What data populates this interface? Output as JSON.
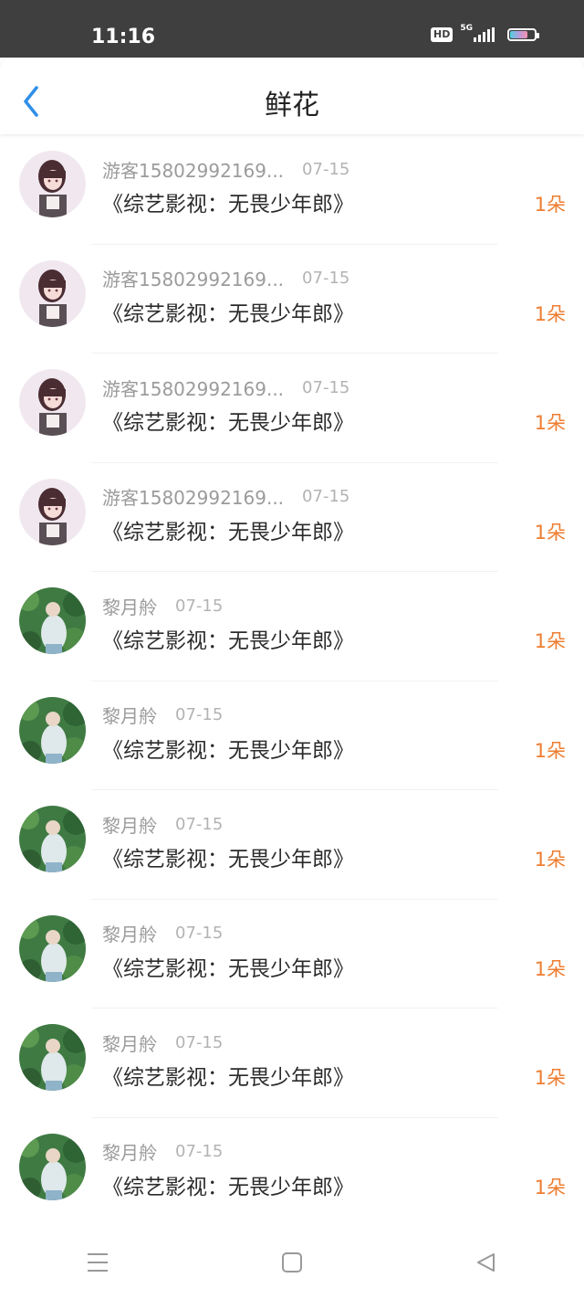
{
  "status_bar": {
    "time": "11:16",
    "hd_badge": "HD",
    "network": "5G"
  },
  "header": {
    "title": "鲜花",
    "back_icon": "chevron-left-icon",
    "accent_color": "#2f8fe8"
  },
  "list": {
    "items": [
      {
        "sender": "游客15802992169...",
        "date": "07-15",
        "title": "《综艺影视：无畏少年郎》",
        "count": "1朵",
        "avatar": "anime-girl"
      },
      {
        "sender": "游客15802992169...",
        "date": "07-15",
        "title": "《综艺影视：无畏少年郎》",
        "count": "1朵",
        "avatar": "anime-girl"
      },
      {
        "sender": "游客15802992169...",
        "date": "07-15",
        "title": "《综艺影视：无畏少年郎》",
        "count": "1朵",
        "avatar": "anime-girl"
      },
      {
        "sender": "游客15802992169...",
        "date": "07-15",
        "title": "《综艺影视：无畏少年郎》",
        "count": "1朵",
        "avatar": "anime-girl"
      },
      {
        "sender": "黎月舲",
        "date": "07-15",
        "title": "《综艺影视：无畏少年郎》",
        "count": "1朵",
        "avatar": "garden-photo"
      },
      {
        "sender": "黎月舲",
        "date": "07-15",
        "title": "《综艺影视：无畏少年郎》",
        "count": "1朵",
        "avatar": "garden-photo"
      },
      {
        "sender": "黎月舲",
        "date": "07-15",
        "title": "《综艺影视：无畏少年郎》",
        "count": "1朵",
        "avatar": "garden-photo"
      },
      {
        "sender": "黎月舲",
        "date": "07-15",
        "title": "《综艺影视：无畏少年郎》",
        "count": "1朵",
        "avatar": "garden-photo"
      },
      {
        "sender": "黎月舲",
        "date": "07-15",
        "title": "《综艺影视：无畏少年郎》",
        "count": "1朵",
        "avatar": "garden-photo"
      },
      {
        "sender": "黎月舲",
        "date": "07-15",
        "title": "《综艺影视：无畏少年郎》",
        "count": "1朵",
        "avatar": "garden-photo"
      }
    ]
  },
  "bottom_nav": {
    "icons": [
      "menu-icon",
      "home-square-icon",
      "back-triangle-icon"
    ]
  },
  "colors": {
    "count": "#ee7d30",
    "sender": "#9b9b9b",
    "title": "#2b2b2b",
    "status_bar": "#3f3f3f"
  }
}
